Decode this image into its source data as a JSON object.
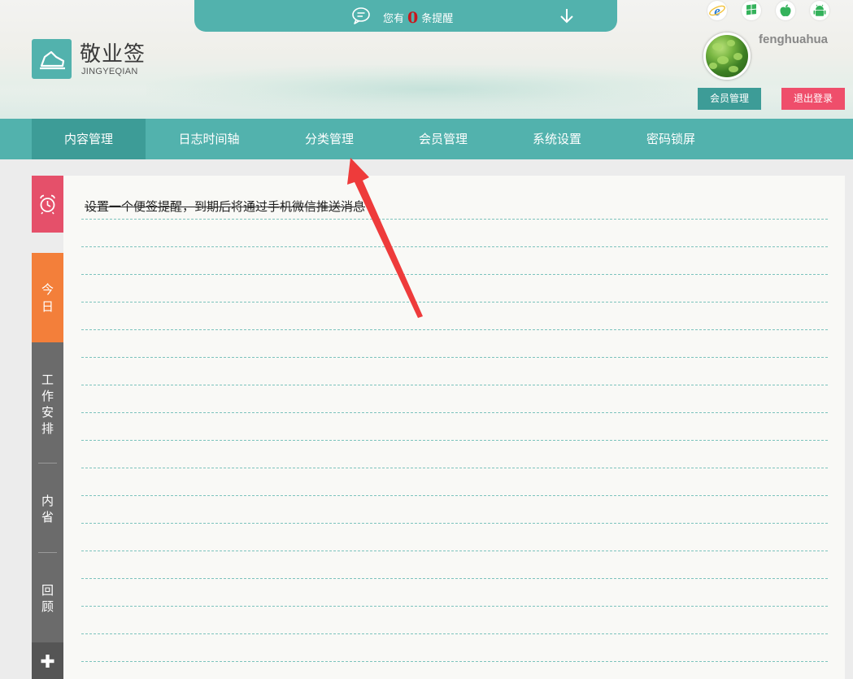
{
  "notice": {
    "prefix": "您有",
    "count": "0",
    "suffix": "条提醒",
    "chat_icon": "chat-bubble-icon",
    "expand_icon": "arrow-down-icon"
  },
  "brand": {
    "title": "敬业签",
    "subtitle": "JINGYEQIAN",
    "logo_icon": "shoe-logo-icon"
  },
  "platforms": [
    "ie-icon",
    "windows-icon",
    "apple-icon",
    "android-icon"
  ],
  "user": {
    "name": "fenghuahua",
    "member_button": "会员管理",
    "logout_button": "退出登录"
  },
  "nav": {
    "items": [
      "内容管理",
      "日志时间轴",
      "分类管理",
      "会员管理",
      "系统设置",
      "密码锁屏"
    ],
    "active": 0
  },
  "sidebar": {
    "alarm_icon": "alarm-clock-icon",
    "today": [
      "今",
      "日"
    ],
    "work": [
      "工",
      "作",
      "安",
      "排"
    ],
    "reflect": [
      "内",
      "省"
    ],
    "review": [
      "回",
      "顾"
    ],
    "add_icon": "plus-icon"
  },
  "note": {
    "text": "设置一个便签提醒，到期后将通过手机微信推送消息"
  },
  "colors": {
    "teal": "#52b2ad",
    "teal_dark": "#3d9c97",
    "pink": "#e5506a",
    "orange": "#f37f3a",
    "grey": "#6b6b6b",
    "logout": "#ef4e6b",
    "pointer_arrow": "#ee3b3b"
  }
}
